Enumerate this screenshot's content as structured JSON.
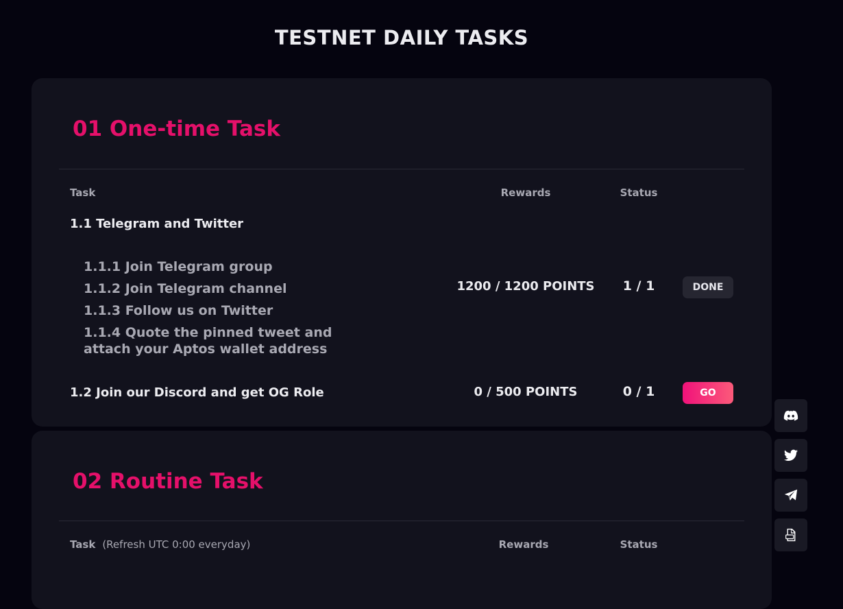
{
  "header": {
    "title": "TESTNET DAILY TASKS"
  },
  "sections": [
    {
      "title": "01 One-time Task",
      "columns": {
        "task": "Task",
        "rewards": "Rewards",
        "status": "Status"
      },
      "groups": [
        {
          "label": "1.1 Telegram and Twitter",
          "subtasks": [
            "1.1.1 Join Telegram group",
            "1.1.2 Join Telegram channel",
            "1.1.3 Follow us on Twitter",
            "1.1.4 Quote the pinned tweet and attach your Aptos wallet address"
          ],
          "reward": "1200 / 1200 POINTS",
          "status": "1 / 1",
          "action": "DONE"
        },
        {
          "label": "1.2 Join our Discord and get OG Role",
          "reward": "0 / 500 POINTS",
          "status": "0 / 1",
          "action": "GO"
        }
      ]
    },
    {
      "title": "02 Routine Task",
      "columns": {
        "task": "Task",
        "task_note": "(Refresh UTC 0:00 everyday)",
        "rewards": "Rewards",
        "status": "Status"
      }
    }
  ],
  "social": [
    {
      "icon": "discord-icon"
    },
    {
      "icon": "twitter-icon"
    },
    {
      "icon": "telegram-icon"
    },
    {
      "icon": "document-icon"
    }
  ],
  "colors": {
    "background": "#05040f",
    "card": "#12121d",
    "accent": "#e5106a",
    "button_done": "#262631",
    "button_go": "#f1127a"
  }
}
